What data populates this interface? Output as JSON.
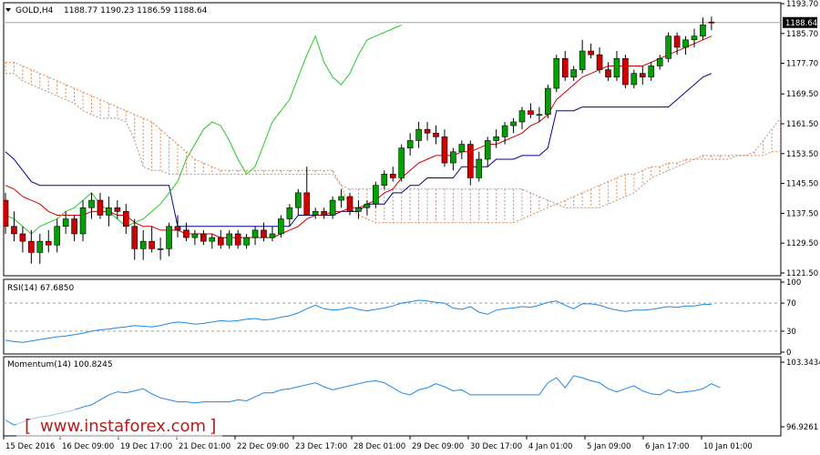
{
  "header": {
    "symbol": "GOLD,H4",
    "ohlc": "1188.77 1190.23 1186.59 1188.64"
  },
  "indicators": {
    "rsi_label": "RSI(14) 67.6850",
    "momentum_label": "Momentum(14) 100.8245"
  },
  "watermark": {
    "text": "www.instaforex.com"
  },
  "colors": {
    "bull": "#00a000",
    "bear": "#d00000",
    "tenkan": "#d00000",
    "kijun": "#000090",
    "chikou": "#22cc22",
    "cloud_a": "#b89090",
    "cloud_b": "#e08850",
    "rsi": "#1e88e5",
    "momentum": "#1e88e5",
    "price_badge": "#000000"
  },
  "chart_data": [
    {
      "type": "candlestick",
      "current_price": "1188.64",
      "ylim": [
        1121.5,
        1193.7
      ],
      "y_ticks": [
        "1193.70",
        "1185.70",
        "1177.70",
        "1169.50",
        "1161.50",
        "1153.50",
        "1145.50",
        "1137.50",
        "1129.50",
        "1121.50"
      ],
      "x_ticks": [
        "15 Dec 2016",
        "16 Dec 09:00",
        "19 Dec 17:00",
        "21 Dec 01:00",
        "22 Dec 09:00",
        "23 Dec 17:00",
        "28 Dec 01:00",
        "29 Dec 09:00",
        "30 Dec 17:00",
        "4 Jan 01:00",
        "5 Jan 09:00",
        "6 Jan 17:00",
        "10 Jan 01:00"
      ],
      "candles": [
        [
          1141,
          1143,
          1132,
          1134
        ],
        [
          1134,
          1138,
          1130,
          1132
        ],
        [
          1132,
          1134,
          1127,
          1130
        ],
        [
          1130,
          1133,
          1124,
          1127
        ],
        [
          1127,
          1132,
          1124,
          1130
        ],
        [
          1130,
          1133,
          1127,
          1129
        ],
        [
          1129,
          1136,
          1127,
          1134
        ],
        [
          1134,
          1138,
          1132,
          1136
        ],
        [
          1136,
          1137,
          1130,
          1132
        ],
        [
          1132,
          1141,
          1130,
          1139
        ],
        [
          1139,
          1143,
          1136,
          1141
        ],
        [
          1141,
          1143,
          1136,
          1137
        ],
        [
          1137,
          1142,
          1134,
          1139
        ],
        [
          1139,
          1141,
          1136,
          1138
        ],
        [
          1138,
          1140,
          1132,
          1134
        ],
        [
          1134,
          1136,
          1125,
          1128
        ],
        [
          1128,
          1133,
          1125,
          1130
        ],
        [
          1130,
          1134,
          1127,
          1128
        ],
        [
          1128,
          1131,
          1125,
          1128
        ],
        [
          1128,
          1135,
          1126,
          1134
        ],
        [
          1134,
          1137,
          1131,
          1133
        ],
        [
          1133,
          1135,
          1130,
          1131
        ],
        [
          1131,
          1133,
          1129,
          1132
        ],
        [
          1132,
          1133,
          1129,
          1130
        ],
        [
          1130,
          1132,
          1128,
          1131
        ],
        [
          1131,
          1133,
          1128,
          1129
        ],
        [
          1129,
          1133,
          1128,
          1132
        ],
        [
          1132,
          1133,
          1128,
          1129
        ],
        [
          1129,
          1132,
          1128,
          1131
        ],
        [
          1131,
          1134,
          1129,
          1133
        ],
        [
          1133,
          1135,
          1130,
          1131
        ],
        [
          1131,
          1134,
          1130,
          1132
        ],
        [
          1132,
          1137,
          1131,
          1136
        ],
        [
          1136,
          1140,
          1134,
          1139
        ],
        [
          1139,
          1144,
          1137,
          1143
        ],
        [
          1143,
          1150,
          1140,
          1137
        ],
        [
          1137,
          1139,
          1136,
          1138
        ],
        [
          1138,
          1139,
          1136,
          1137
        ],
        [
          1137,
          1142,
          1136,
          1141
        ],
        [
          1141,
          1144,
          1139,
          1142
        ],
        [
          1142,
          1143,
          1137,
          1138
        ],
        [
          1138,
          1141,
          1136,
          1139
        ],
        [
          1139,
          1141,
          1137,
          1140
        ],
        [
          1140,
          1146,
          1139,
          1145
        ],
        [
          1145,
          1149,
          1144,
          1148
        ],
        [
          1148,
          1150,
          1146,
          1147
        ],
        [
          1147,
          1156,
          1146,
          1155
        ],
        [
          1155,
          1159,
          1153,
          1157
        ],
        [
          1157,
          1162,
          1155,
          1160
        ],
        [
          1160,
          1162,
          1157,
          1159
        ],
        [
          1159,
          1161,
          1156,
          1158
        ],
        [
          1158,
          1160,
          1150,
          1151
        ],
        [
          1151,
          1155,
          1149,
          1154
        ],
        [
          1154,
          1157,
          1152,
          1156
        ],
        [
          1156,
          1157,
          1145,
          1147
        ],
        [
          1147,
          1154,
          1146,
          1152
        ],
        [
          1152,
          1158,
          1150,
          1157
        ],
        [
          1157,
          1160,
          1155,
          1158
        ],
        [
          1158,
          1162,
          1156,
          1161
        ],
        [
          1161,
          1163,
          1159,
          1162
        ],
        [
          1162,
          1166,
          1160,
          1165
        ],
        [
          1165,
          1167,
          1163,
          1164
        ],
        [
          1164,
          1166,
          1162,
          1164
        ],
        [
          1164,
          1172,
          1163,
          1171
        ],
        [
          1171,
          1180,
          1170,
          1179
        ],
        [
          1179,
          1181,
          1173,
          1174
        ],
        [
          1174,
          1177,
          1173,
          1176
        ],
        [
          1176,
          1184,
          1175,
          1181
        ],
        [
          1181,
          1183,
          1179,
          1180
        ],
        [
          1180,
          1182,
          1175,
          1176
        ],
        [
          1176,
          1178,
          1173,
          1174
        ],
        [
          1174,
          1181,
          1173,
          1179
        ],
        [
          1179,
          1180,
          1171,
          1172
        ],
        [
          1172,
          1176,
          1171,
          1175
        ],
        [
          1175,
          1177,
          1172,
          1174
        ],
        [
          1174,
          1178,
          1173,
          1177
        ],
        [
          1177,
          1180,
          1176,
          1179
        ],
        [
          1179,
          1186,
          1178,
          1185
        ],
        [
          1185,
          1186,
          1180,
          1182
        ],
        [
          1182,
          1185,
          1180,
          1184
        ],
        [
          1184,
          1187,
          1182,
          1185
        ],
        [
          1185,
          1190,
          1184,
          1188
        ],
        [
          1188.77,
          1190.23,
          1186.59,
          1188.64
        ]
      ],
      "tenkan": [
        1145,
        1144,
        1142,
        1141,
        1140,
        1138,
        1137,
        1137,
        1137,
        1137,
        1138,
        1138,
        1138,
        1137,
        1137,
        1135,
        1134,
        1134,
        1133,
        1133,
        1133,
        1132,
        1132,
        1132,
        1132,
        1131,
        1131,
        1131,
        1131,
        1131,
        1131,
        1131,
        1132,
        1133,
        1134,
        1136,
        1137,
        1137,
        1138,
        1138,
        1139,
        1139,
        1140,
        1141,
        1143,
        1144,
        1147,
        1149,
        1151,
        1152,
        1153,
        1153,
        1153,
        1154,
        1154,
        1155,
        1156,
        1156,
        1157,
        1158,
        1159,
        1161,
        1162,
        1164,
        1168,
        1170,
        1172,
        1174,
        1175,
        1176,
        1177,
        1177,
        1177,
        1177,
        1177,
        1178,
        1179,
        1180,
        1181,
        1182,
        1183,
        1184,
        1185
      ],
      "kijun": [
        1154,
        1152,
        1149,
        1146,
        1145,
        1145,
        1145,
        1145,
        1145,
        1145,
        1145,
        1145,
        1145,
        1145,
        1145,
        1145,
        1145,
        1145,
        1145,
        1145,
        1134,
        1134,
        1134,
        1134,
        1134,
        1134,
        1134,
        1134,
        1134,
        1134,
        1134,
        1134,
        1134,
        1134,
        1137,
        1137,
        1137,
        1137,
        1137,
        1138,
        1138,
        1138,
        1140,
        1140,
        1140,
        1143,
        1143,
        1145,
        1145,
        1147,
        1147,
        1147,
        1147,
        1150,
        1150,
        1150,
        1150,
        1152,
        1152,
        1152,
        1153,
        1153,
        1153,
        1155,
        1165,
        1165,
        1165,
        1166,
        1166,
        1166,
        1166,
        1166,
        1166,
        1166,
        1166,
        1166,
        1166,
        1166,
        1168,
        1170,
        1172,
        1174,
        1175
      ],
      "chikou": [
        1137,
        1136,
        1134,
        1132,
        1134,
        1135,
        1136,
        1138,
        1139,
        1141,
        1143,
        1140,
        1138,
        1136,
        1134,
        1135,
        1136,
        1138,
        1140,
        1143,
        1146,
        1152,
        1156,
        1160,
        1162,
        1161,
        1157,
        1152,
        1148,
        1150,
        1156,
        1162,
        1165,
        1168,
        1174,
        1180,
        1185,
        1178,
        1174,
        1172,
        1175,
        1180,
        1184,
        1185,
        1186,
        1187,
        1188
      ],
      "span_a": [
        1175,
        1175,
        1173,
        1172,
        1171,
        1170,
        1169,
        1168,
        1167,
        1165,
        1164,
        1163,
        1163,
        1163,
        1162,
        1157,
        1150,
        1149,
        1149,
        1148,
        1148,
        1148,
        1148,
        1148,
        1148,
        1148,
        1148,
        1148,
        1148,
        1148,
        1148,
        1148,
        1148,
        1148,
        1148,
        1148,
        1148,
        1148,
        1148,
        1145,
        1144,
        1144,
        1144,
        1144,
        1144,
        1144,
        1144,
        1144,
        1144,
        1144,
        1144,
        1144,
        1144,
        1144,
        1144,
        1144,
        1144,
        1144,
        1144,
        1144,
        1144,
        1143,
        1142,
        1141,
        1140,
        1139,
        1139,
        1139,
        1139,
        1139,
        1140,
        1141,
        1142,
        1143,
        1145,
        1147,
        1148,
        1149,
        1150,
        1151,
        1152,
        1153,
        1153,
        1153,
        1153,
        1153,
        1153,
        1154,
        1157,
        1160,
        1163,
        1165
      ],
      "span_b": [
        1178,
        1178,
        1177,
        1176,
        1175,
        1174,
        1173,
        1172,
        1171,
        1170,
        1169,
        1168,
        1167,
        1166,
        1165,
        1164,
        1163,
        1162,
        1160,
        1158,
        1156,
        1154,
        1152,
        1151,
        1150,
        1149,
        1149,
        1149,
        1149,
        1149,
        1149,
        1149,
        1149,
        1149,
        1149,
        1149,
        1149,
        1149,
        1149,
        1145,
        1139,
        1137,
        1136,
        1135,
        1135,
        1135,
        1135,
        1135,
        1135,
        1135,
        1135,
        1135,
        1135,
        1135,
        1135,
        1135,
        1135,
        1135,
        1135,
        1135,
        1136,
        1137,
        1138,
        1139,
        1140,
        1141,
        1142,
        1143,
        1144,
        1145,
        1146,
        1147,
        1148,
        1148,
        1149,
        1150,
        1150,
        1151,
        1151,
        1152,
        1152,
        1152,
        1152,
        1152,
        1152,
        1153,
        1153,
        1153,
        1153,
        1154,
        1154,
        1154
      ]
    },
    {
      "type": "line",
      "name": "RSI(14)",
      "ylim": [
        0,
        100
      ],
      "y_ticks": [
        "100",
        "70",
        "30",
        "0"
      ],
      "levels": [
        70,
        30
      ],
      "values": [
        17,
        15,
        14,
        16,
        18,
        20,
        22,
        23,
        25,
        27,
        30,
        32,
        33,
        35,
        36,
        38,
        37,
        36,
        38,
        41,
        43,
        42,
        40,
        41,
        43,
        45,
        44,
        45,
        47,
        48,
        46,
        47,
        50,
        52,
        56,
        62,
        67,
        62,
        60,
        61,
        64,
        61,
        59,
        61,
        63,
        66,
        70,
        72,
        74,
        73,
        71,
        70,
        63,
        61,
        65,
        57,
        54,
        60,
        62,
        63,
        65,
        64,
        67,
        71,
        73,
        67,
        62,
        69,
        69,
        67,
        63,
        60,
        58,
        60,
        60,
        61,
        63,
        65,
        64,
        66,
        66,
        68,
        68
      ]
    },
    {
      "type": "line",
      "name": "Momentum(14)",
      "ylim": [
        96.9261,
        103.3434
      ],
      "y_ticks": [
        "103.3434",
        "96.9261"
      ],
      "values": [
        97.6,
        97.1,
        97.4,
        97.7,
        97.9,
        98.0,
        98.2,
        98.4,
        98.6,
        98.9,
        99.1,
        99.6,
        100.1,
        100.4,
        100.3,
        100.5,
        100.7,
        100.2,
        99.8,
        99.6,
        99.4,
        99.4,
        99.3,
        99.4,
        99.4,
        99.4,
        99.4,
        99.6,
        99.5,
        99.9,
        100.3,
        100.3,
        100.6,
        100.7,
        100.9,
        101.1,
        101.3,
        100.9,
        100.6,
        100.8,
        101.0,
        101.2,
        101.4,
        101.5,
        101.3,
        100.8,
        100.3,
        100.1,
        100.6,
        100.8,
        101.2,
        100.9,
        100.5,
        100.6,
        100.1,
        100.1,
        100.1,
        100.1,
        100.1,
        100.1,
        100.1,
        100.1,
        100.1,
        101.3,
        101.8,
        100.8,
        102.0,
        101.8,
        101.5,
        101.3,
        100.7,
        100.4,
        100.7,
        101.0,
        100.5,
        100.2,
        100.1,
        100.6,
        100.3,
        100.4,
        100.5,
        100.7,
        101.2,
        100.8
      ]
    }
  ]
}
